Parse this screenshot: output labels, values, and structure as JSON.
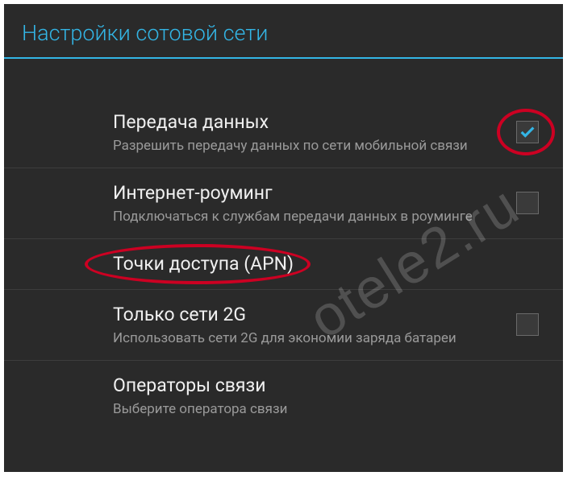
{
  "header": {
    "title": "Настройки сотовой сети"
  },
  "settings": [
    {
      "title": "Передача данных",
      "subtitle": "Разрешить передачу данных по сети мобильной связи",
      "has_checkbox": true,
      "checked": true,
      "highlight_checkbox": true
    },
    {
      "title": "Интернет-роуминг",
      "subtitle": "Подключаться к службам передачи данных в роуминге",
      "has_checkbox": true,
      "checked": false
    },
    {
      "title": "Точки доступа (APN)",
      "subtitle": "",
      "has_checkbox": false,
      "highlight_title": true
    },
    {
      "title": "Только сети 2G",
      "subtitle": "Использовать сети 2G для экономии заряда батареи",
      "has_checkbox": true,
      "checked": false
    },
    {
      "title": "Операторы связи",
      "subtitle": "Выберите оператора связи",
      "has_checkbox": false
    }
  ],
  "watermark": "otele2.ru"
}
